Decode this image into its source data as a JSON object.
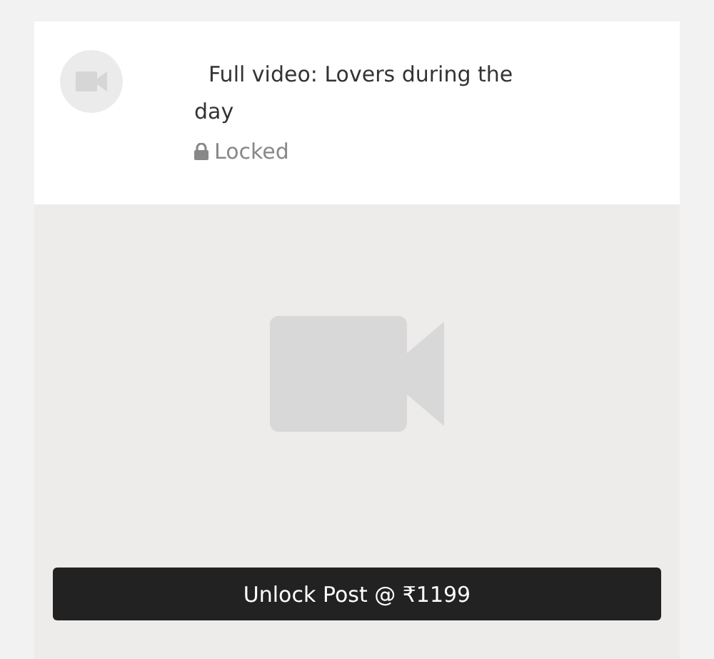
{
  "post": {
    "title": "Full video: Lovers during the day",
    "status": "Locked",
    "locked": true
  },
  "unlock_button": {
    "label": "Unlock Post @ ₹1199"
  }
}
